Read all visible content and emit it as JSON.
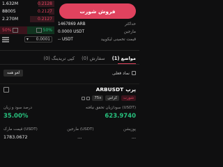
{
  "order_book": {
    "rows": [
      {
        "amount": "1.632M",
        "price": "0.2128",
        "depth": 0.3
      },
      {
        "amount": "88005",
        "price": "0.2127",
        "depth": 0.1
      },
      {
        "amount": "2.270M",
        "price": "0.2127",
        "depth": 0.45
      }
    ],
    "sell_percent": "50%",
    "buy_percent": "50%",
    "depth_value": "0.0001",
    "depth_arrow": "▾"
  },
  "trade_panel": {
    "sell_button_label": "فروش شورت",
    "max_label": "حداکثر",
    "max_value": "1467869 ARB",
    "margin_label": "مارجین",
    "margin_value": "0.0000 USDT",
    "available_label": "قیمت تخمینی لیکویید",
    "available_value": "-- USDT"
  },
  "tabs": [
    {
      "label": "مواضع (1)",
      "active": true
    },
    {
      "label": "سفارش (0)",
      "active": false
    },
    {
      "label": "کپی تریدینگ (0)",
      "active": false
    }
  ],
  "filter": {
    "checkbox_label": "نماد فعلی",
    "cancel_all_label": "لغو همه"
  },
  "position": {
    "symbol": "ARBUSDT",
    "type": "پرپ",
    "share_icon": "share-icon",
    "side_badge": "شورت",
    "margin_mode": "کراس",
    "leverage": "75x",
    "unrealized_pnl_label": "سود/زیان تحقق نیافته (USDT)",
    "roi_label": "درصد سود و زیان",
    "unrealized_pnl_value": "623.9740",
    "roi_value": "35.00%",
    "size_label": "پوزیشن",
    "margin_label": "مارجین (USDT)",
    "mark_label": "قیمت مارک (USDT)",
    "size_value": "...",
    "margin_value": "...",
    "mark_value": "1783.0672"
  },
  "colors": {
    "sell": "#e0425e",
    "buy": "#27c07d",
    "background": "#0f0f10"
  }
}
